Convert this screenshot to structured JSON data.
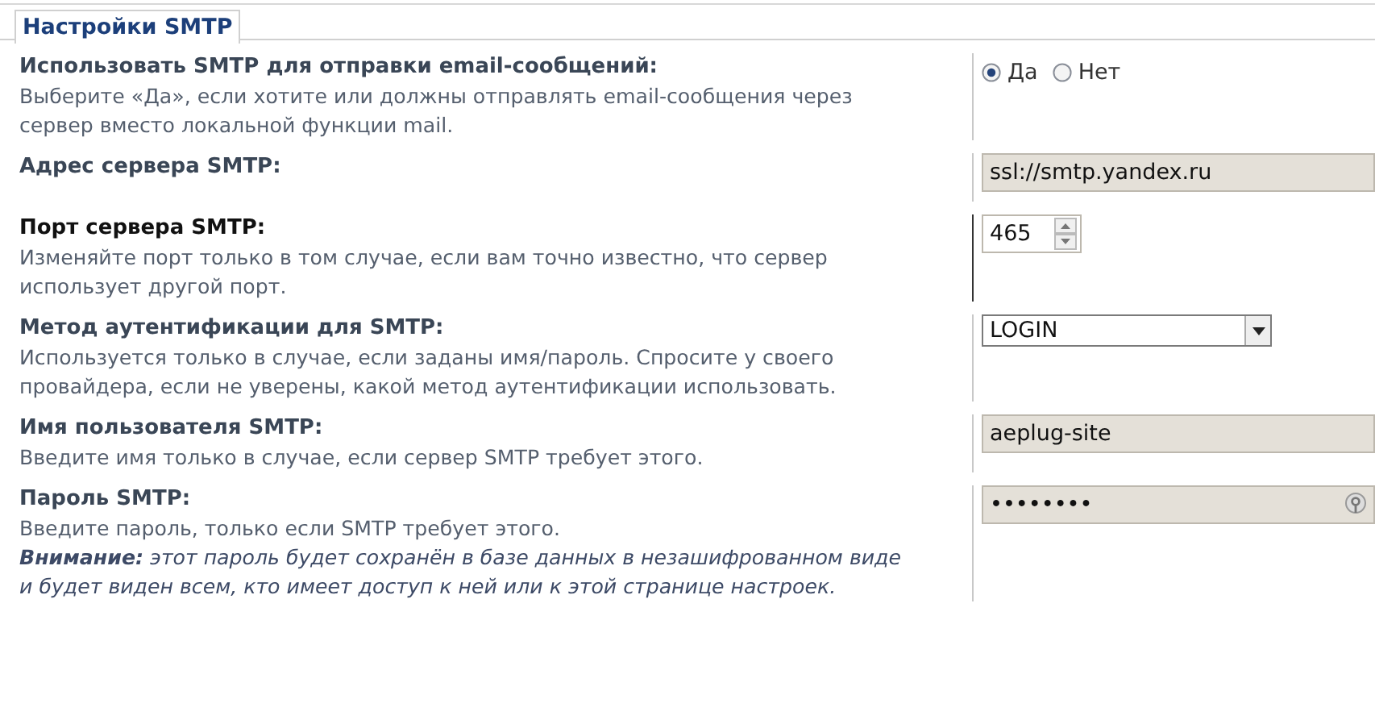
{
  "section": {
    "title": "Настройки SMTP"
  },
  "settings": [
    {
      "kind": "radio",
      "label": "Использовать SMTP для отправки email-сообщений:",
      "description": "Выберите «Да», если хотите или должны отправлять email-сообщения через сервер вместо локальной функции mail.",
      "focused": false,
      "options": [
        {
          "label": "Да",
          "selected": true
        },
        {
          "label": "Нет",
          "selected": false
        }
      ]
    },
    {
      "kind": "text",
      "label": "Адрес сервера SMTP:",
      "focused": false,
      "value": "ssl://smtp.yandex.ru"
    },
    {
      "kind": "number",
      "label": "Порт сервера SMTP:",
      "description": "Изменяйте порт только в том случае, если вам точно известно, что сервер использует другой порт.",
      "focused": true,
      "value": "465"
    },
    {
      "kind": "select",
      "label": "Метод аутентификации для SMTP:",
      "description": "Используется только в случае, если заданы имя/пароль. Спросите у своего провайдера, если не уверены, какой метод аутентификации использовать.",
      "focused": false,
      "value": "LOGIN"
    },
    {
      "kind": "text",
      "label": "Имя пользователя SMTP:",
      "description": "Введите имя только в случае, если сервер SMTP требует этого.",
      "focused": false,
      "value": "aeplug-site"
    },
    {
      "kind": "password",
      "label": "Пароль SMTP:",
      "description": "Введите пароль, только если SMTP требует этого.",
      "warning": "**Внимание:** этот пароль будет сохранён в базе данных в незашифрованном виде и будет виден всем, кто имеет доступ к ней или к этой странице настроек.",
      "focused": false,
      "value": "••••••••"
    }
  ]
}
